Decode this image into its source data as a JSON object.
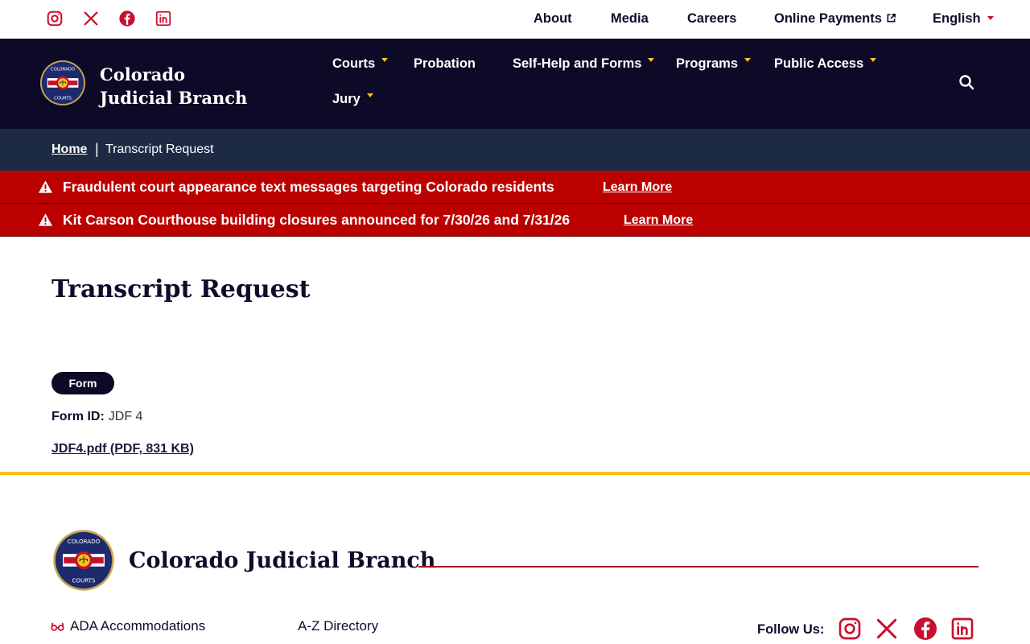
{
  "utility": {
    "social": [
      "instagram-icon",
      "x-icon",
      "facebook-icon",
      "linkedin-icon"
    ],
    "links": {
      "about": "About",
      "media": "Media",
      "careers": "Careers",
      "online_payments": "Online Payments",
      "language": "English"
    }
  },
  "header": {
    "brand_name": "Colorado Judicial Branch",
    "nav": {
      "courts": "Courts",
      "probation": "Probation",
      "self_help": "Self-Help and Forms",
      "programs": "Programs",
      "public_access": "Public Access",
      "jury": "Jury"
    }
  },
  "breadcrumb": {
    "home": "Home",
    "separator": "|",
    "current": "Transcript Request"
  },
  "alerts": [
    {
      "message": "Fraudulent court appearance text messages targeting Colorado residents",
      "link": "Learn More"
    },
    {
      "message": "Kit Carson Courthouse building closures announced for 7/30/26 and 7/31/26",
      "link": "Learn More"
    }
  ],
  "main": {
    "title": "Transcript Request",
    "tag": "Form",
    "form_id_label": "Form ID:",
    "form_id_value": "JDF 4",
    "pdf_link": "JDF4.pdf (PDF, 831 KB)"
  },
  "footer": {
    "brand_name": "Colorado Judicial Branch",
    "ada": "ADA Accommodations",
    "az": "A-Z Directory",
    "follow_label": "Follow Us:"
  },
  "colors": {
    "navy": "#0c0a27",
    "breadcrumb_bg": "#1c2a44",
    "alert_red": "#bb0000",
    "accent_red": "#c8102e",
    "gold": "#f5c518"
  }
}
